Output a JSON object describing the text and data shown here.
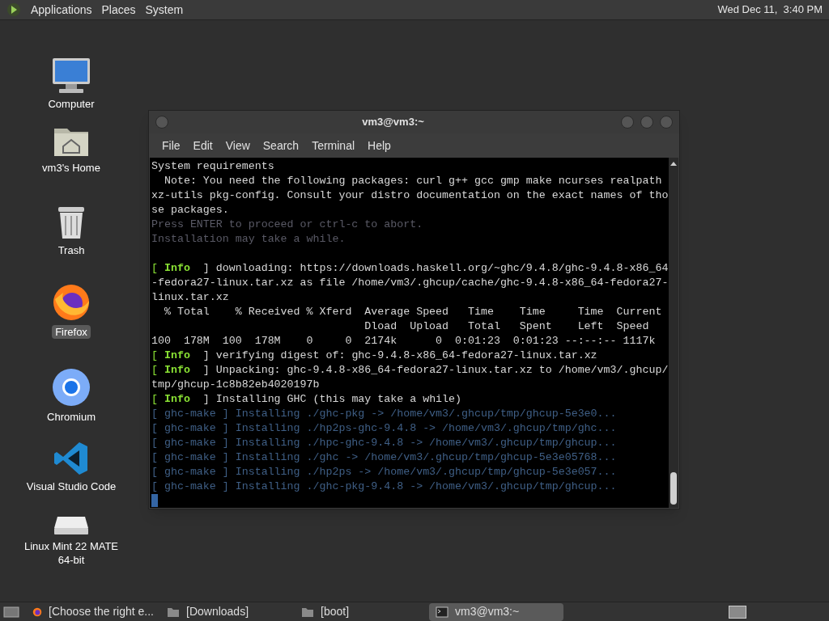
{
  "top_panel": {
    "menus": [
      "Applications",
      "Places",
      "System"
    ],
    "clock": "Wed Dec 11,  3:40 PM"
  },
  "desktop_icons": [
    {
      "kind": "computer",
      "label": "Computer",
      "selected": false
    },
    {
      "kind": "home",
      "label": "vm3's Home",
      "selected": false
    },
    {
      "kind": "trash",
      "label": "Trash",
      "selected": false
    },
    {
      "kind": "firefox",
      "label": "Firefox",
      "selected": true
    },
    {
      "kind": "chromium",
      "label": "Chromium",
      "selected": false
    },
    {
      "kind": "vscode",
      "label": "Visual Studio Code",
      "selected": false
    },
    {
      "kind": "drive",
      "label": "Linux Mint 22 MATE 64-bit",
      "selected": false
    }
  ],
  "terminal": {
    "title": "vm3@vm3:~",
    "menus": [
      "File",
      "Edit",
      "View",
      "Search",
      "Terminal",
      "Help"
    ],
    "lines": [
      {
        "kind": "plain",
        "text": "System requirements"
      },
      {
        "kind": "plain",
        "text": "  Note: You need the following packages: curl g++ gcc gmp make ncurses realpath"
      },
      {
        "kind": "plain",
        "text": "xz-utils pkg-config. Consult your distro documentation on the exact names of tho"
      },
      {
        "kind": "plain",
        "text": "se packages."
      },
      {
        "kind": "dim",
        "text": "Press ENTER to proceed or ctrl-c to abort."
      },
      {
        "kind": "dim",
        "text": "Installation may take a while."
      },
      {
        "kind": "blank"
      },
      {
        "kind": "info",
        "parts": [
          "[ ",
          "Info",
          "  ] downloading: https://downloads.haskell.org/~ghc/9.4.8/ghc-9.4.8-x86_64"
        ]
      },
      {
        "kind": "plain",
        "text": "-fedora27-linux.tar.xz as file /home/vm3/.ghcup/cache/ghc-9.4.8-x86_64-fedora27-"
      },
      {
        "kind": "plain",
        "text": "linux.tar.xz"
      },
      {
        "kind": "plain",
        "text": "  % Total    % Received % Xferd  Average Speed   Time    Time     Time  Current"
      },
      {
        "kind": "plain",
        "text": "                                 Dload  Upload   Total   Spent    Left  Speed"
      },
      {
        "kind": "plain",
        "text": "100  178M  100  178M    0     0  2174k      0  0:01:23  0:01:23 --:--:-- 1117k"
      },
      {
        "kind": "info",
        "parts": [
          "[ ",
          "Info",
          "  ] verifying digest of: ghc-9.4.8-x86_64-fedora27-linux.tar.xz"
        ]
      },
      {
        "kind": "info",
        "parts": [
          "[ ",
          "Info",
          "  ] Unpacking: ghc-9.4.8-x86_64-fedora27-linux.tar.xz to /home/vm3/.ghcup/"
        ]
      },
      {
        "kind": "plain",
        "text": "tmp/ghcup-1c8b82eb4020197b"
      },
      {
        "kind": "info",
        "parts": [
          "[ ",
          "Info",
          "  ] Installing GHC (this may take a while)"
        ]
      },
      {
        "kind": "make",
        "text": "[ ghc-make ] Installing ./ghc-pkg -> /home/vm3/.ghcup/tmp/ghcup-5e3e0..."
      },
      {
        "kind": "make",
        "text": "[ ghc-make ] Installing ./hp2ps-ghc-9.4.8 -> /home/vm3/.ghcup/tmp/ghc..."
      },
      {
        "kind": "make",
        "text": "[ ghc-make ] Installing ./hpc-ghc-9.4.8 -> /home/vm3/.ghcup/tmp/ghcup..."
      },
      {
        "kind": "make",
        "text": "[ ghc-make ] Installing ./ghc -> /home/vm3/.ghcup/tmp/ghcup-5e3e05768..."
      },
      {
        "kind": "make",
        "text": "[ ghc-make ] Installing ./hp2ps -> /home/vm3/.ghcup/tmp/ghcup-5e3e057..."
      },
      {
        "kind": "make",
        "text": "[ ghc-make ] Installing ./ghc-pkg-9.4.8 -> /home/vm3/.ghcup/tmp/ghcup..."
      }
    ]
  },
  "taskbar": {
    "items": [
      {
        "kind": "firefox",
        "label": "[Choose the right e...",
        "selected": false
      },
      {
        "kind": "folder",
        "label": "[Downloads]",
        "selected": false
      },
      {
        "kind": "folder",
        "label": "[boot]",
        "selected": false
      },
      {
        "kind": "terminal",
        "label": "vm3@vm3:~",
        "selected": true
      }
    ]
  }
}
